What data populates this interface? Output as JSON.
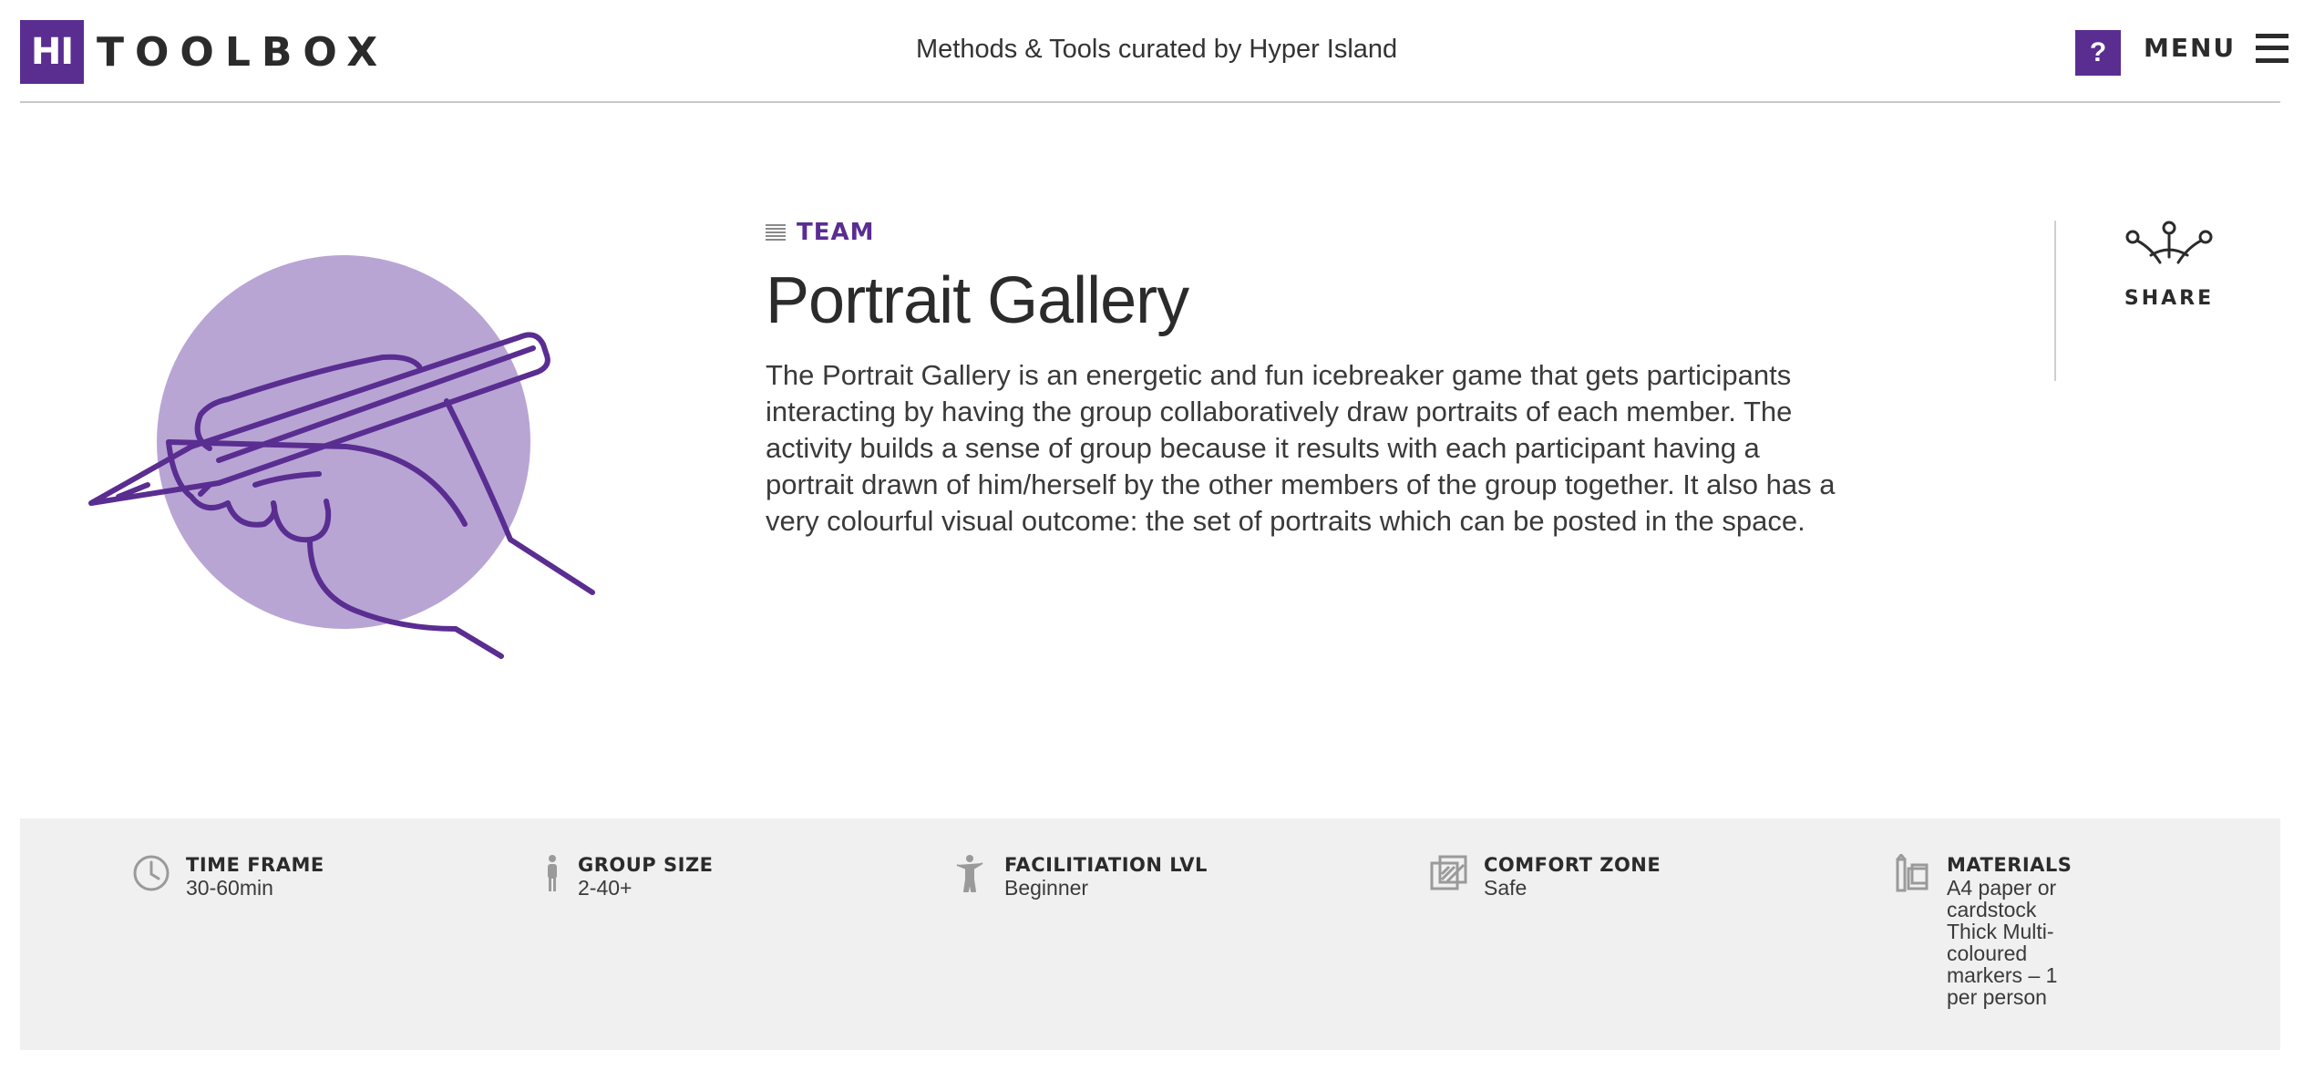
{
  "header": {
    "logo_mark": "HI",
    "logo_word": "TOOLBOX",
    "tagline": "Methods & Tools curated by Hyper Island",
    "help_label": "?",
    "menu_label": "MENU"
  },
  "method": {
    "category": "TEAM",
    "title": "Portrait Gallery",
    "description": "The Portrait Gallery is an energetic and fun icebreaker game that gets participants interacting by having the group collaboratively draw portraits of each member. The activity builds a sense of group because it results with each participant having a portrait drawn of him/herself by the other members of the group together. It also has a very colourful visual outcome: the set of portraits which can be posted in the space."
  },
  "share": {
    "label": "SHARE"
  },
  "info": {
    "time_frame": {
      "label": "TIME FRAME",
      "value": "30-60min",
      "icon": "clock-icon"
    },
    "group_size": {
      "label": "GROUP SIZE",
      "value": "2-40+",
      "icon": "person-icon"
    },
    "facilitation": {
      "label": "FACILITIATION LVL",
      "value": "Beginner",
      "icon": "facilitator-icon"
    },
    "comfort_zone": {
      "label": "COMFORT ZONE",
      "value": "Safe",
      "icon": "comfort-zone-icon"
    },
    "materials": {
      "label": "MATERIALS",
      "value": "A4 paper or cardstock Thick Multi-coloured markers – 1 per person",
      "icon": "materials-icon"
    }
  },
  "colors": {
    "brand": "#5a2d91",
    "brand_light": "#b8a5d4",
    "infobar_bg": "#eff0ef"
  }
}
